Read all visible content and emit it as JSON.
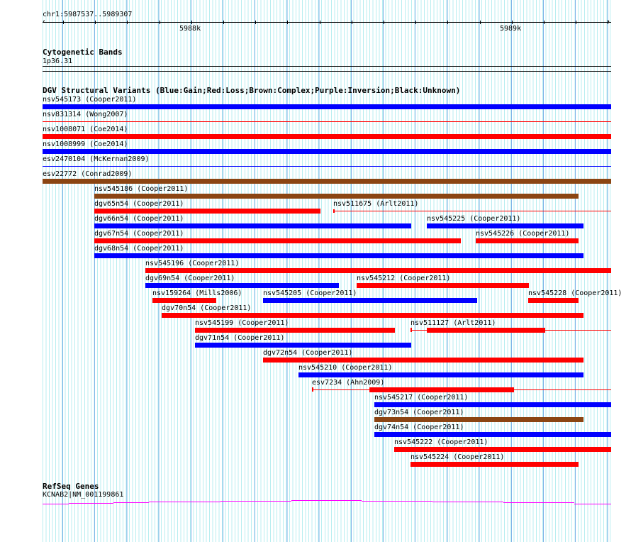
{
  "ruler": {
    "range": "chr1:5987537..5989307",
    "ticks": [
      "5988k",
      "5989k"
    ]
  },
  "cyto": {
    "title": "Cytogenetic Bands",
    "band": "1p36.31"
  },
  "dgv": {
    "title": "DGV Structural Variants (Blue:Gain;Red:Loss;Brown:Complex;Purple:Inversion;Black:Unknown)",
    "colors": {
      "gain": "#0000ff",
      "loss": "#ff0000",
      "complex": "#8b4513"
    },
    "features": [
      {
        "label": "nsv545173 (Cooper2011)",
        "type": "gain"
      },
      {
        "label": "nsv831314 (Wong2007)",
        "type": "loss"
      },
      {
        "label": "nsv1008071 (Coe2014)",
        "type": "loss"
      },
      {
        "label": "nsv1008999 (Coe2014)",
        "type": "gain"
      },
      {
        "label": "esv2470104 (McKernan2009)",
        "type": "gain"
      },
      {
        "label": "esv22772 (Conrad2009)",
        "type": "complex"
      },
      {
        "label": "nsv545186 (Cooper2011)",
        "type": "complex"
      },
      {
        "label": "dgv65n54 (Cooper2011)",
        "type": "loss"
      },
      {
        "label": "nsv511675 (Arlt2011)",
        "type": "loss"
      },
      {
        "label": "dgv66n54 (Cooper2011)",
        "type": "gain"
      },
      {
        "label": "nsv545225 (Cooper2011)",
        "type": "gain"
      },
      {
        "label": "dgv67n54 (Cooper2011)",
        "type": "loss"
      },
      {
        "label": "nsv545226 (Cooper2011)",
        "type": "loss"
      },
      {
        "label": "dgv68n54 (Cooper2011)",
        "type": "gain"
      },
      {
        "label": "nsv545196 (Cooper2011)",
        "type": "loss"
      },
      {
        "label": "dgv69n54 (Cooper2011)",
        "type": "gain"
      },
      {
        "label": "nsv545212 (Cooper2011)",
        "type": "loss"
      },
      {
        "label": "nsv159264 (Mills2006)",
        "type": "loss"
      },
      {
        "label": "nsv545205 (Cooper2011)",
        "type": "gain"
      },
      {
        "label": "nsv545228 (Cooper2011)",
        "type": "loss"
      },
      {
        "label": "dgv70n54 (Cooper2011)",
        "type": "loss"
      },
      {
        "label": "nsv545199 (Cooper2011)",
        "type": "loss"
      },
      {
        "label": "nsv511127 (Arlt2011)",
        "type": "loss"
      },
      {
        "label": "dgv71n54 (Cooper2011)",
        "type": "gain"
      },
      {
        "label": "dgv72n54 (Cooper2011)",
        "type": "loss"
      },
      {
        "label": "nsv545210 (Cooper2011)",
        "type": "gain"
      },
      {
        "label": "esv7234 (Ahn2009)",
        "type": "loss"
      },
      {
        "label": "nsv545217 (Cooper2011)",
        "type": "gain"
      },
      {
        "label": "dgv73n54 (Cooper2011)",
        "type": "complex"
      },
      {
        "label": "dgv74n54 (Cooper2011)",
        "type": "gain"
      },
      {
        "label": "nsv545222 (Cooper2011)",
        "type": "loss"
      },
      {
        "label": "nsv545224 (Cooper2011)",
        "type": "loss"
      }
    ]
  },
  "refseq": {
    "title": "RefSeq Genes",
    "gene": "KCNAB2|NM_001199861",
    "color": "#ff00ff"
  }
}
